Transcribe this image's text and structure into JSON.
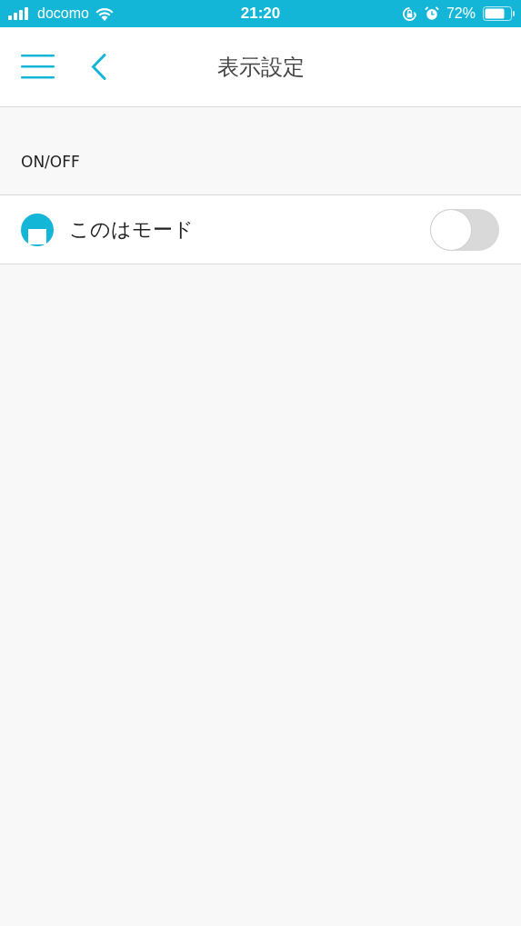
{
  "status_bar": {
    "carrier": "docomo",
    "time": "21:20",
    "battery": "72%"
  },
  "nav_bar": {
    "title": "表示設定"
  },
  "section": {
    "header": "ON/OFF",
    "rows": [
      {
        "label": "このはモード",
        "on": false
      }
    ]
  }
}
